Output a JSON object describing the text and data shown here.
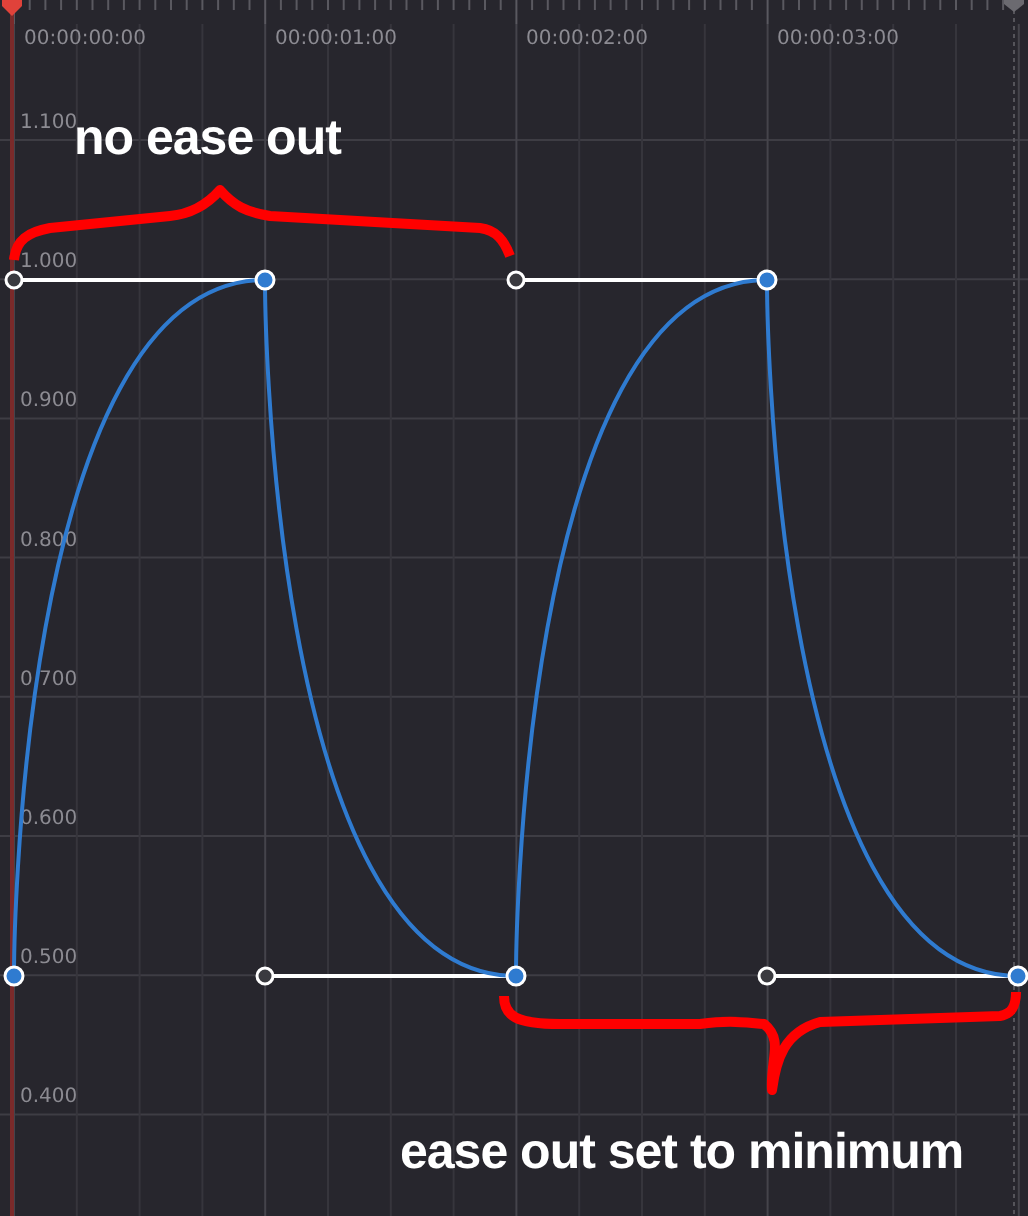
{
  "timeline": {
    "labels": [
      "00:00:00:00",
      "00:00:01:00",
      "00:00:02:00",
      "00:00:03:00"
    ]
  },
  "value_axis": {
    "labels": [
      "1.100",
      "1.000",
      "0.900",
      "0.800",
      "0.700",
      "0.600",
      "0.500",
      "0.400"
    ]
  },
  "annotations": [
    {
      "text": "no ease out",
      "kind": "top"
    },
    {
      "text": "ease out set to minimum",
      "kind": "bottom"
    }
  ]
}
